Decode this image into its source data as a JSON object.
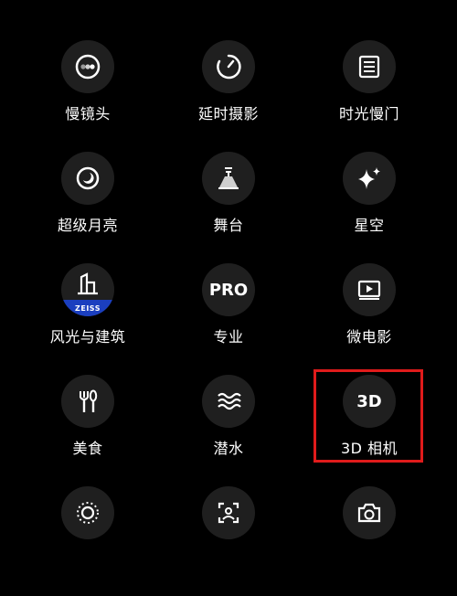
{
  "modes": [
    {
      "label": "慢镜头"
    },
    {
      "label": "延时摄影"
    },
    {
      "label": "时光慢门"
    },
    {
      "label": "超级月亮"
    },
    {
      "label": "舞台"
    },
    {
      "label": "星空"
    },
    {
      "label": "风光与建筑",
      "badge": "ZEISS"
    },
    {
      "label": "专业",
      "icon_text": "PRO"
    },
    {
      "label": "微电影"
    },
    {
      "label": "美食"
    },
    {
      "label": "潜水"
    },
    {
      "label": "3D 相机",
      "icon_text": "3D"
    }
  ],
  "highlight_color": "#e01b1b",
  "icons": [
    "slow-motion-icon",
    "timelapse-icon",
    "long-exposure-icon",
    "moon-icon",
    "stage-light-icon",
    "sparkle-icon",
    "building-icon",
    "pro-icon",
    "movie-icon",
    "cutlery-icon",
    "water-waves-icon",
    "3d-icon",
    "circle-dots-icon",
    "face-scan-icon",
    "camera-switch-icon"
  ]
}
